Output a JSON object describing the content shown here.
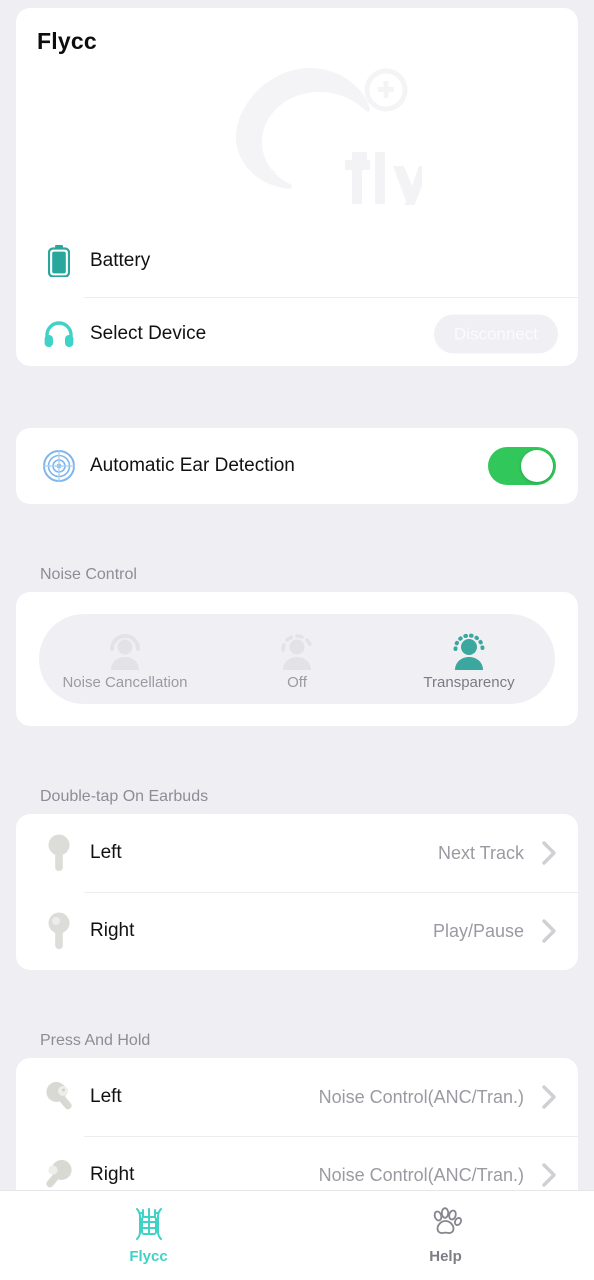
{
  "app": {
    "title": "Flycc",
    "watermark_text": "fly",
    "background": "#eeeef3",
    "accent": "#3fd2c7"
  },
  "device_card": {
    "rows": [
      {
        "icon": "battery-icon",
        "label": "Battery"
      },
      {
        "icon": "headphones-icon",
        "label": "Select Device",
        "action_label": "Disconnect",
        "action_disabled": true
      }
    ]
  },
  "ear_detection": {
    "icon": "radar-target-icon",
    "label": "Automatic Ear Detection",
    "toggle_on": true,
    "toggle_color": "#32c75a"
  },
  "noise_control": {
    "header": "Noise Control",
    "selected": "Transparency",
    "options": [
      {
        "label": "Noise Cancellation",
        "icon": "person-solid-ring-icon",
        "active": false
      },
      {
        "label": "Off",
        "icon": "person-dashed-ring-icon",
        "active": false
      },
      {
        "label": "Transparency",
        "icon": "person-dotted-ring-icon",
        "active": true
      }
    ]
  },
  "double_tap": {
    "header": "Double-tap On Earbuds",
    "rows": [
      {
        "icon": "earbud-left-icon",
        "label": "Left",
        "value": "Next Track"
      },
      {
        "icon": "earbud-right-icon",
        "label": "Right",
        "value": "Play/Pause"
      }
    ]
  },
  "press_and_hold": {
    "header": "Press And Hold",
    "rows": [
      {
        "icon": "earbud-tilt-left-icon",
        "label": "Left",
        "value": "Noise Control(ANC/Tran.)"
      },
      {
        "icon": "earbud-tilt-right-icon",
        "label": "Right",
        "value": "Noise Control(ANC/Tran.)"
      }
    ]
  },
  "tabbar": {
    "tabs": [
      {
        "label": "Flycc",
        "icon": "flycc-glyph-icon",
        "active": true
      },
      {
        "label": "Help",
        "icon": "paw-print-icon",
        "active": false
      }
    ]
  }
}
